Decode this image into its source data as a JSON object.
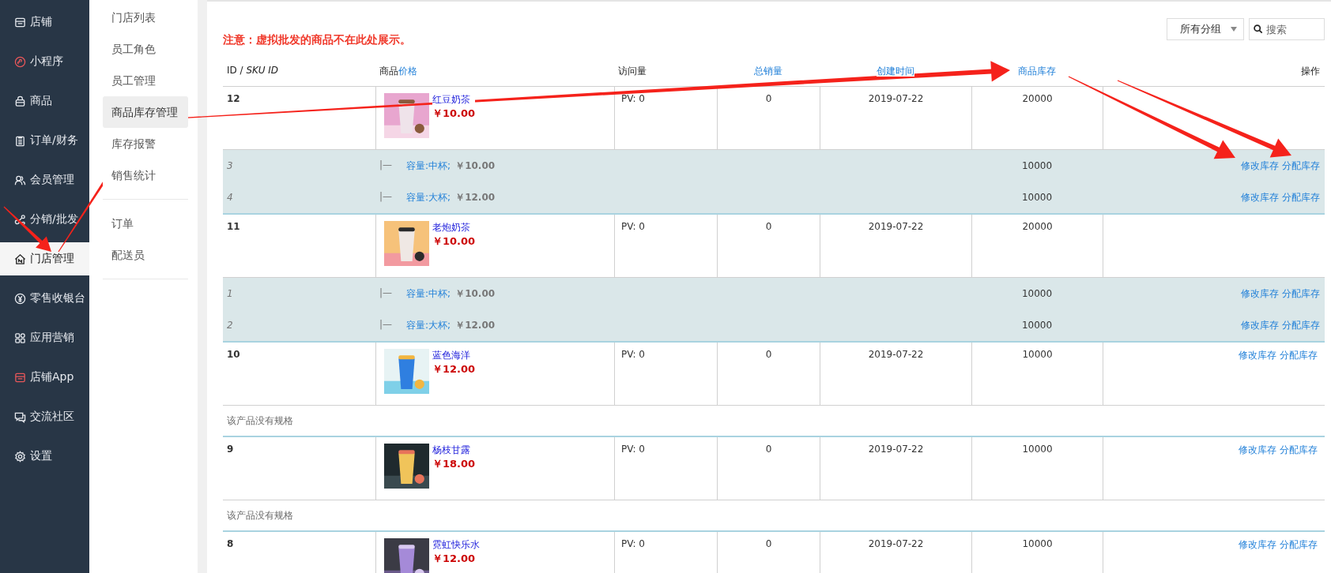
{
  "sidebar": {
    "items": [
      {
        "label": "店铺",
        "kind": "store",
        "selected": false
      },
      {
        "label": "小程序",
        "kind": "miniapp",
        "selected": false
      },
      {
        "label": "商品",
        "kind": "bag",
        "selected": false
      },
      {
        "label": "订单/财务",
        "kind": "clipboard",
        "selected": false
      },
      {
        "label": "会员管理",
        "kind": "people",
        "selected": false
      },
      {
        "label": "分销/批发",
        "kind": "share",
        "selected": false
      },
      {
        "label": "门店管理",
        "kind": "house",
        "selected": true
      },
      {
        "label": "零售收银台",
        "kind": "yen",
        "selected": false
      },
      {
        "label": "应用营销",
        "kind": "apps",
        "selected": false
      },
      {
        "label": "店铺App",
        "kind": "storeapp",
        "selected": false
      },
      {
        "label": "交流社区",
        "kind": "chat",
        "selected": false
      },
      {
        "label": "设置",
        "kind": "gear",
        "selected": false
      }
    ]
  },
  "submenu": {
    "groups": [
      [
        {
          "label": "门店列表",
          "selected": false
        },
        {
          "label": "员工角色",
          "selected": false
        },
        {
          "label": "员工管理",
          "selected": false
        },
        {
          "label": "商品库存管理",
          "selected": true
        },
        {
          "label": "库存报警",
          "selected": false
        },
        {
          "label": "销售统计",
          "selected": false
        }
      ],
      [
        {
          "label": "订单",
          "selected": false
        },
        {
          "label": "配送员",
          "selected": false
        }
      ]
    ]
  },
  "notice": "注意：虚拟批发的商品不在此处展示。",
  "group_select": "所有分组",
  "search": {
    "placeholder": "搜索"
  },
  "table": {
    "columns": [
      {
        "label": "ID / *SKU ID*",
        "link": false
      },
      {
        "label": "商品",
        "extra": "价格",
        "link": false
      },
      {
        "label": "访问量",
        "link": false
      },
      {
        "label": "总销量",
        "link": true
      },
      {
        "label": "创建时间",
        "link": true
      },
      {
        "label": "商品库存",
        "link": true
      },
      {
        "label": "操作",
        "link": false
      }
    ],
    "rows": [
      {
        "id": "12",
        "name": "红豆奶茶",
        "price": "￥10.00",
        "pv": "PV: 0",
        "sales": "0",
        "created": "2019-07-22",
        "stock": "20000",
        "actions": [],
        "skus": [
          {
            "id": "3",
            "branch": "|—",
            "spec": "容量:中杯;",
            "price": "￥10.00",
            "stock": "10000",
            "actions": [
              "修改库存",
              "分配库存"
            ]
          },
          {
            "id": "4",
            "branch": "|—",
            "spec": "容量:大杯;",
            "price": "￥12.00",
            "stock": "10000",
            "actions": [
              "修改库存",
              "分配库存"
            ]
          }
        ]
      },
      {
        "id": "11",
        "name": "老炮奶茶",
        "price": "￥10.00",
        "pv": "PV: 0",
        "sales": "0",
        "created": "2019-07-22",
        "stock": "20000",
        "actions": [],
        "skus": [
          {
            "id": "1",
            "branch": "|—",
            "spec": "容量:中杯;",
            "price": "￥10.00",
            "stock": "10000",
            "actions": [
              "修改库存",
              "分配库存"
            ]
          },
          {
            "id": "2",
            "branch": "|—",
            "spec": "容量:大杯;",
            "price": "￥12.00",
            "stock": "10000",
            "actions": [
              "修改库存",
              "分配库存"
            ]
          }
        ]
      },
      {
        "id": "10",
        "name": "蓝色海洋",
        "price": "￥12.00",
        "pv": "PV: 0",
        "sales": "0",
        "created": "2019-07-22",
        "stock": "10000",
        "actions": [
          "修改库存",
          "分配库存"
        ],
        "no_spec": "该产品没有规格"
      },
      {
        "id": "9",
        "name": "杨枝甘露",
        "price": "￥18.00",
        "pv": "PV: 0",
        "sales": "0",
        "created": "2019-07-22",
        "stock": "10000",
        "actions": [
          "修改库存",
          "分配库存"
        ],
        "no_spec": "该产品没有规格"
      },
      {
        "id": "8",
        "name": "霓虹快乐水",
        "price": "￥12.00",
        "pv": "PV: 0",
        "sales": "0",
        "created": "2019-07-22",
        "stock": "10000",
        "actions": [
          "修改库存",
          "分配库存"
        ]
      }
    ]
  }
}
